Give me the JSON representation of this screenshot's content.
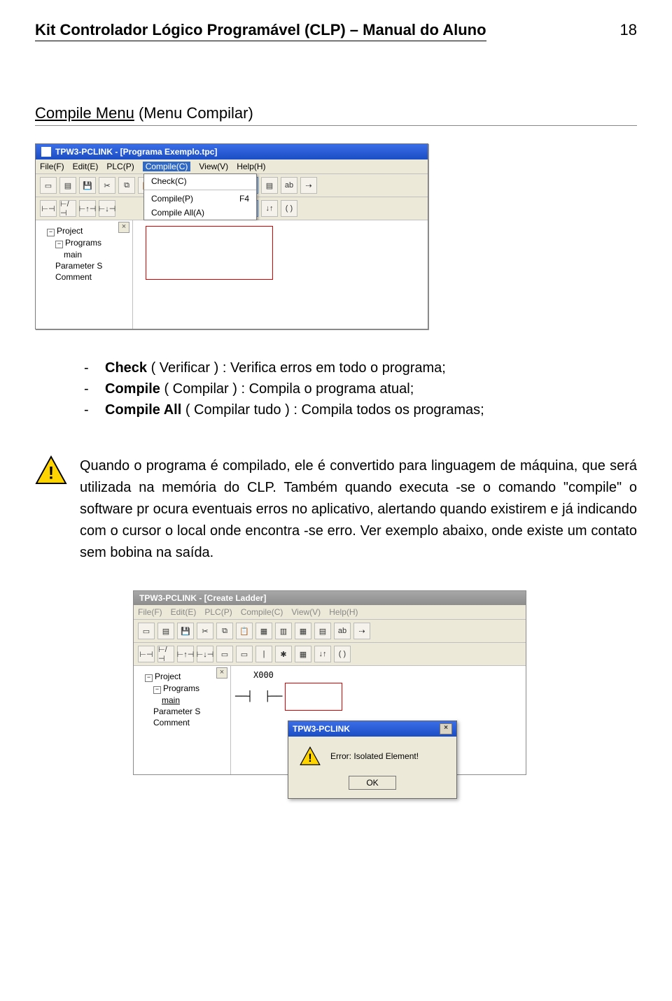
{
  "header": {
    "title": "Kit Controlador Lógico Programável (CLP) – Manual do Aluno",
    "page_number": "18"
  },
  "section": {
    "title_underlined": "Compile Menu",
    "title_rest": " (Menu Compilar)"
  },
  "screenshot1": {
    "window_title": "TPW3-PCLINK - [Programa Exemplo.tpc]",
    "menus": {
      "file": "File(F)",
      "edit": "Edit(E)",
      "plc": "PLC(P)",
      "compile": "Compile(C)",
      "view": "View(V)",
      "help": "Help(H)"
    },
    "dropdown": {
      "check": "Check(C)",
      "compile": "Compile(P)",
      "compile_shortcut": "F4",
      "compile_all": "Compile All(A)"
    },
    "tree": {
      "project": "Project",
      "programs": "Programs",
      "main": "main",
      "parameter": "Parameter S",
      "comment": "Comment"
    }
  },
  "bullets": {
    "b1_bold": "Check",
    "b1_rest": " ( Verificar ) : Verifica erros em todo o programa;",
    "b2_bold": "Compile",
    "b2_rest": " ( Compilar ) : Compila o programa atual;",
    "b3_bold": "Compile All",
    "b3_rest": "  ( Compilar tudo ) : Compila todos os  programas;"
  },
  "note": {
    "text": "Quando o programa é compilado, ele é convertido para linguagem de máquina, que será utilizada na memória do CLP. Também quando executa -se o comando \"compile\" o software pr ocura eventuais erros no aplicativo, alertando quando existirem e já indicando com o cursor o local onde encontra -se erro. Ver exemplo abaixo, onde existe um contato sem bobina na saída."
  },
  "screenshot2": {
    "window_title": "TPW3-PCLINK - [Create Ladder]",
    "menus": {
      "file": "File(F)",
      "edit": "Edit(E)",
      "plc": "PLC(P)",
      "compile": "Compile(C)",
      "view": "View(V)",
      "help": "Help(H)"
    },
    "tree": {
      "project": "Project",
      "programs": "Programs",
      "main": "main",
      "parameter": "Parameter S",
      "comment": "Comment"
    },
    "contact_label": "X000",
    "dialog": {
      "title": "TPW3-PCLINK",
      "message": "Error: Isolated Element!",
      "ok": "OK"
    }
  }
}
